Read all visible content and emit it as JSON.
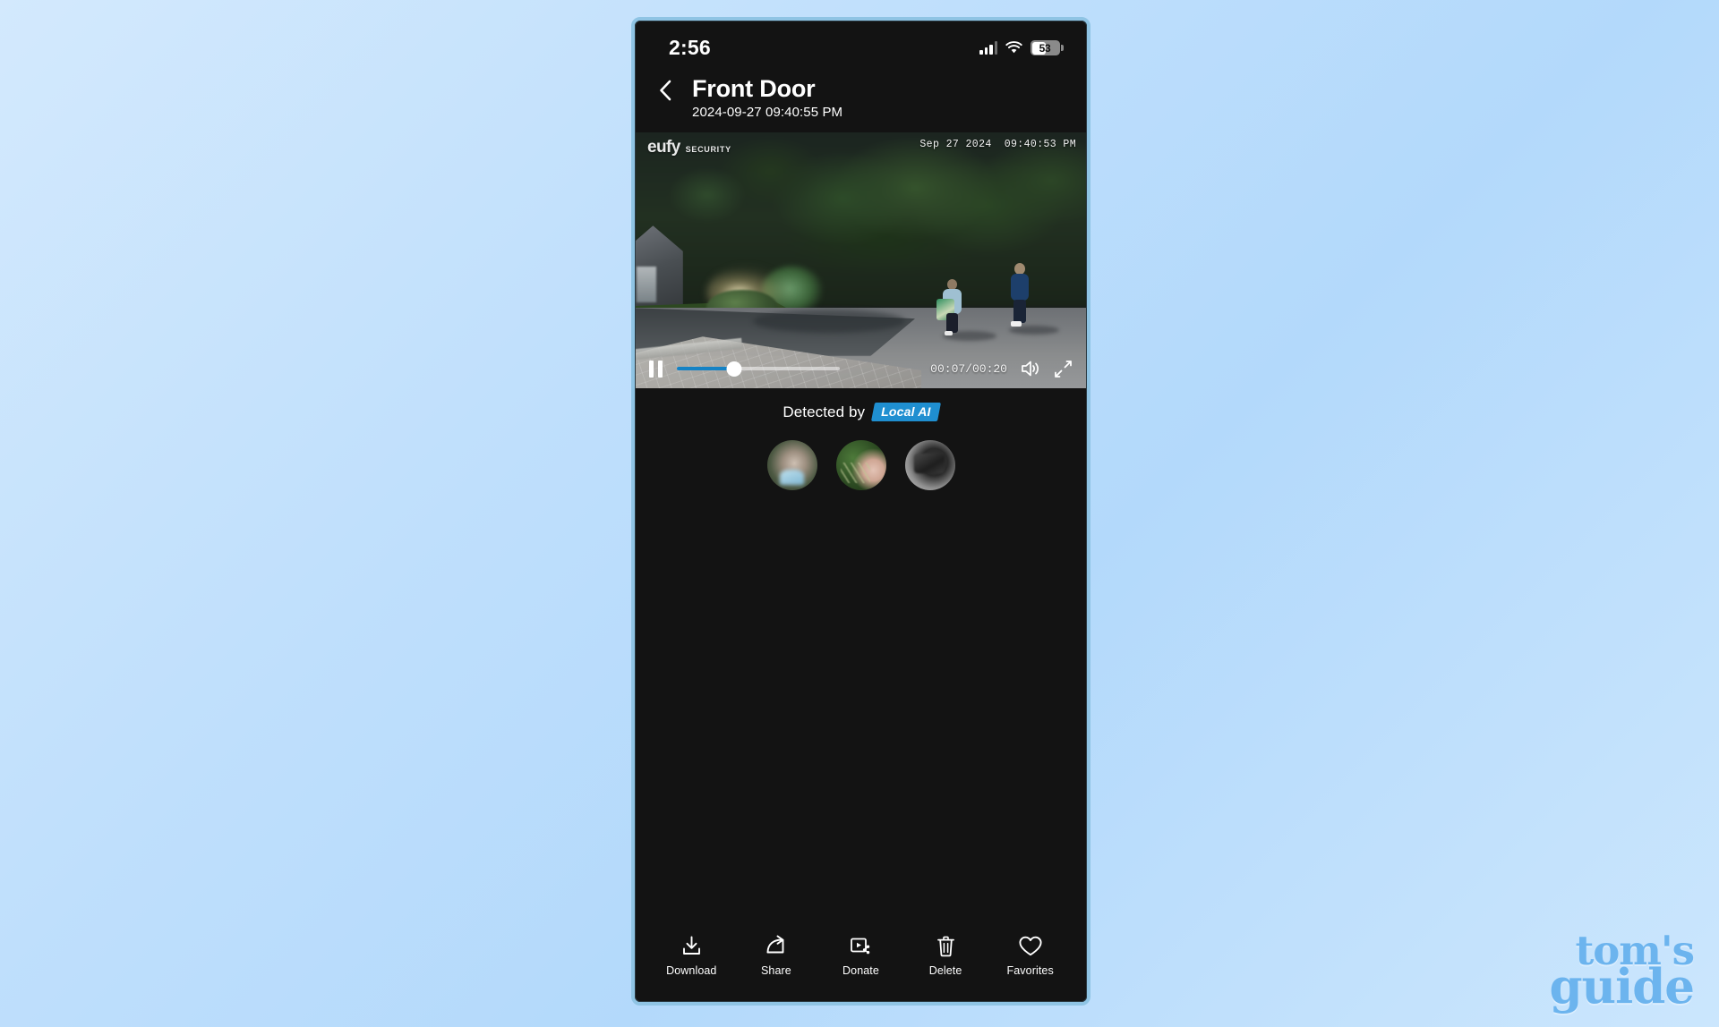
{
  "status_bar": {
    "clock": "2:56",
    "signal_icon": "cellular-signal-icon",
    "wifi_icon": "wifi-icon",
    "battery_percent": "53",
    "battery_icon": "battery-icon"
  },
  "header": {
    "back_icon": "back-chevron-icon",
    "title": "Front Door",
    "subtitle": "2024-09-27 09:40:55 PM"
  },
  "video": {
    "watermark_brand": "eufy",
    "watermark_sub": "SECURITY",
    "stamp_date": "Sep 27 2024",
    "stamp_time": "09:40:53 PM",
    "controls": {
      "pause_icon": "pause-icon",
      "time_display": "00:07/00:20",
      "progress_percent": 35,
      "volume_icon": "speaker-on-icon",
      "fullscreen_icon": "fullscreen-expand-icon"
    }
  },
  "detection": {
    "label": "Detected by",
    "badge": "Local AI",
    "badge_color": "#1f8fd1",
    "thumbnails": [
      {
        "name": "detection-thumbnail-1"
      },
      {
        "name": "detection-thumbnail-2"
      },
      {
        "name": "detection-thumbnail-3"
      }
    ]
  },
  "toolbar": {
    "items": [
      {
        "label": "Download",
        "icon": "download-icon"
      },
      {
        "label": "Share",
        "icon": "share-arrow-icon"
      },
      {
        "label": "Donate",
        "icon": "donate-video-share-icon"
      },
      {
        "label": "Delete",
        "icon": "trash-icon"
      },
      {
        "label": "Favorites",
        "icon": "heart-icon"
      }
    ]
  },
  "watermark": {
    "line1": "tom's",
    "line2": "guide",
    "color": "#6cb4ee"
  }
}
